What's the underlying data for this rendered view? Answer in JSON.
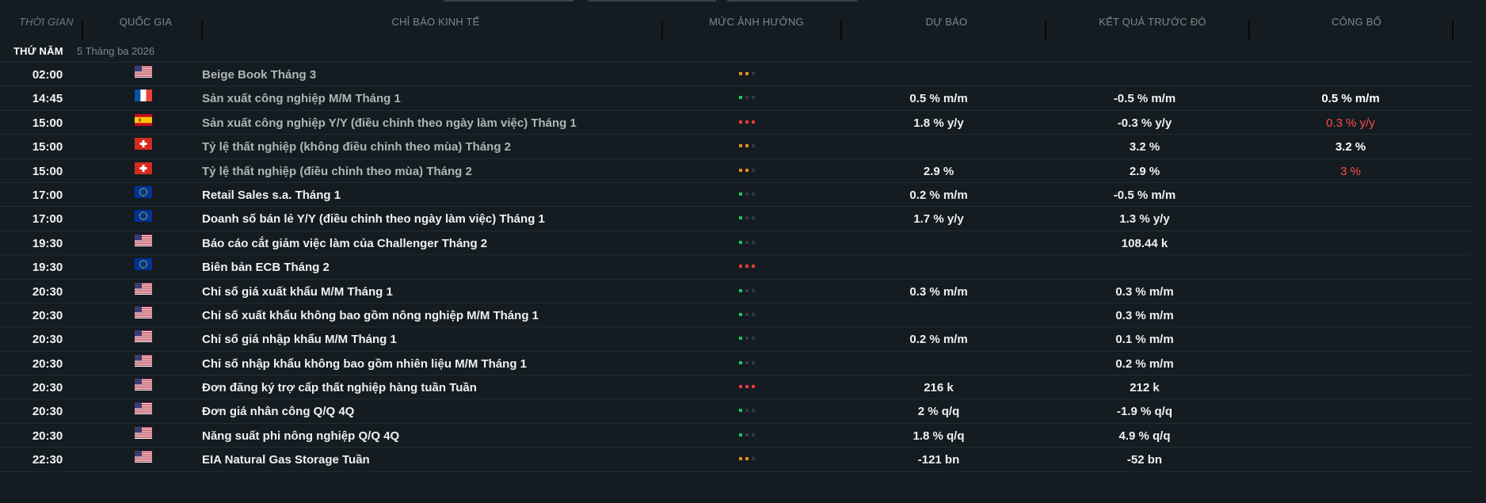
{
  "header": {
    "time": "THỜI GIAN",
    "country": "QUỐC GIA",
    "indicator": "CHỈ BÁO KINH TẾ",
    "impact": "MỨC ẢNH HƯỞNG",
    "forecast": "DỰ BÁO",
    "previous": "KẾT QUẢ TRƯỚC ĐÓ",
    "actual": "CÔNG BỐ"
  },
  "day": {
    "name": "THỨ NĂM",
    "date": "5 Tháng ba 2026"
  },
  "colors": {
    "impact_high": "#e33b3b",
    "impact_medium": "#e08a1e",
    "impact_low": "#22c55e",
    "inactive": "#2f3a3f",
    "actual_negative": "#ff4b4b"
  },
  "events": [
    {
      "time": "02:00",
      "country": "US",
      "name": "Beige Book Tháng 3",
      "impact": "medium",
      "forecast": "",
      "previous": "",
      "actual": "",
      "muted": true
    },
    {
      "time": "14:45",
      "country": "FR",
      "name": "Sản xuất công nghiệp M/M Tháng 1",
      "impact": "low",
      "forecast": "0.5 % m/m",
      "previous": "-0.5 % m/m",
      "actual": "0.5 % m/m",
      "muted": true
    },
    {
      "time": "15:00",
      "country": "ES",
      "name": "Sản xuất công nghiệp Y/Y (điều chỉnh theo ngày làm việc) Tháng 1",
      "impact": "high",
      "forecast": "1.8 % y/y",
      "previous": "-0.3 % y/y",
      "actual": "0.3 % y/y",
      "actual_negative": true,
      "muted": true
    },
    {
      "time": "15:00",
      "country": "CH",
      "name": "Tỷ lệ thất nghiệp (không điều chỉnh theo mùa) Tháng 2",
      "impact": "medium",
      "forecast": "",
      "previous": "3.2 %",
      "actual": "3.2 %",
      "muted": true
    },
    {
      "time": "15:00",
      "country": "CH",
      "name": "Tỷ lệ thất nghiệp (điều chỉnh theo mùa) Tháng 2",
      "impact": "medium",
      "forecast": "2.9 %",
      "previous": "2.9 %",
      "actual": "3 %",
      "actual_negative": true,
      "muted": true
    },
    {
      "time": "17:00",
      "country": "EU",
      "name": "Retail Sales s.a. Tháng 1",
      "impact": "low",
      "forecast": "0.2 % m/m",
      "previous": "-0.5 % m/m",
      "actual": ""
    },
    {
      "time": "17:00",
      "country": "EU",
      "name": "Doanh số bán lẻ Y/Y (điều chỉnh theo ngày làm việc) Tháng 1",
      "impact": "low",
      "forecast": "1.7 % y/y",
      "previous": "1.3 % y/y",
      "actual": ""
    },
    {
      "time": "19:30",
      "country": "US",
      "name": "Báo cáo cắt giảm việc làm của Challenger Tháng 2",
      "impact": "low",
      "forecast": "",
      "previous": "108.44 k",
      "actual": ""
    },
    {
      "time": "19:30",
      "country": "EU",
      "name": "Biên bản ECB Tháng 2",
      "impact": "high",
      "forecast": "",
      "previous": "",
      "actual": ""
    },
    {
      "time": "20:30",
      "country": "US",
      "name": "Chỉ số giá xuất khẩu M/M Tháng 1",
      "impact": "low",
      "forecast": "0.3 % m/m",
      "previous": "0.3 % m/m",
      "actual": ""
    },
    {
      "time": "20:30",
      "country": "US",
      "name": "Chỉ số xuất khẩu không bao gồm nông nghiệp M/M Tháng 1",
      "impact": "low",
      "forecast": "",
      "previous": "0.3 % m/m",
      "actual": ""
    },
    {
      "time": "20:30",
      "country": "US",
      "name": "Chỉ số giá nhập khẩu M/M Tháng 1",
      "impact": "low",
      "forecast": "0.2 % m/m",
      "previous": "0.1 % m/m",
      "actual": ""
    },
    {
      "time": "20:30",
      "country": "US",
      "name": "Chỉ số nhập khẩu không bao gồm nhiên liệu M/M Tháng 1",
      "impact": "low",
      "forecast": "",
      "previous": "0.2 % m/m",
      "actual": ""
    },
    {
      "time": "20:30",
      "country": "US",
      "name": "Đơn đăng ký trợ cấp thất nghiệp hàng tuần Tuần",
      "impact": "high",
      "forecast": "216 k",
      "previous": "212 k",
      "actual": ""
    },
    {
      "time": "20:30",
      "country": "US",
      "name": "Đơn giá nhân công Q/Q 4Q",
      "impact": "low",
      "forecast": "2 % q/q",
      "previous": "-1.9 % q/q",
      "actual": ""
    },
    {
      "time": "20:30",
      "country": "US",
      "name": "Năng suất phi nông nghiệp Q/Q 4Q",
      "impact": "low",
      "forecast": "1.8 % q/q",
      "previous": "4.9 % q/q",
      "actual": ""
    },
    {
      "time": "22:30",
      "country": "US",
      "name": "EIA Natural Gas Storage Tuần",
      "impact": "medium",
      "forecast": "-121 bn",
      "previous": "-52 bn",
      "actual": ""
    }
  ]
}
